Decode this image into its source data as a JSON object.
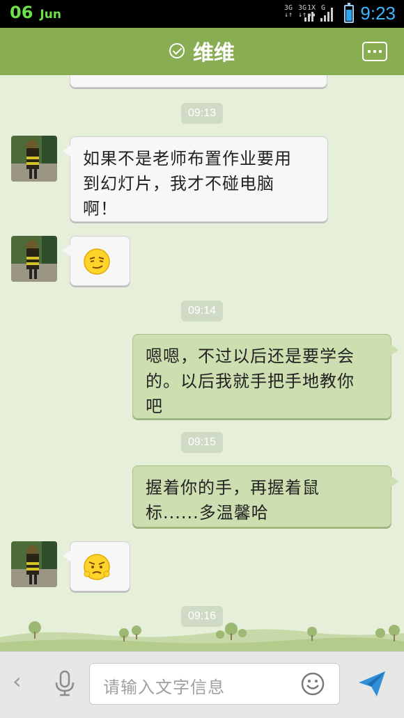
{
  "status_bar": {
    "day": "06",
    "month": "Jun",
    "time": "9:23",
    "network_labels": [
      "3G",
      "3G",
      "1X",
      "G"
    ],
    "battery_level": 0.8
  },
  "header": {
    "title": "维维",
    "check_icon": "check-circle-icon",
    "menu_icon": "more-dots-icon"
  },
  "messages": {
    "time_1": "09:13",
    "msg_1_lines": [
      "如果不是老师布置作业要用",
      "到幻灯片，我才不碰电脑",
      "啊！"
    ],
    "msg_2_emoji": "smirk-emoji",
    "time_2": "09:14",
    "msg_3_lines": [
      "嗯嗯，不过以后还是要学会",
      "的。以后我就手把手地教你",
      "吧"
    ],
    "time_3": "09:15",
    "msg_4_lines": [
      "握着你的手，再握着鼠",
      "标......多温馨哈"
    ],
    "msg_5_emoji": "grumpy-emoji",
    "time_4": "09:16"
  },
  "input_bar": {
    "back_icon": "chevron-left-icon",
    "back_label": "‹",
    "mic_icon": "microphone-icon",
    "placeholder": "请输入文字信息",
    "emoji_icon": "smiley-icon",
    "send_icon": "send-icon"
  },
  "colors": {
    "header": "#88ad52",
    "chat_background": "#e6efd9",
    "outgoing_bubble": "#cddfb1",
    "incoming_bubble": "#f7f7f7",
    "time_accent": "#3bb6ff",
    "date_accent": "#6ee14a"
  }
}
